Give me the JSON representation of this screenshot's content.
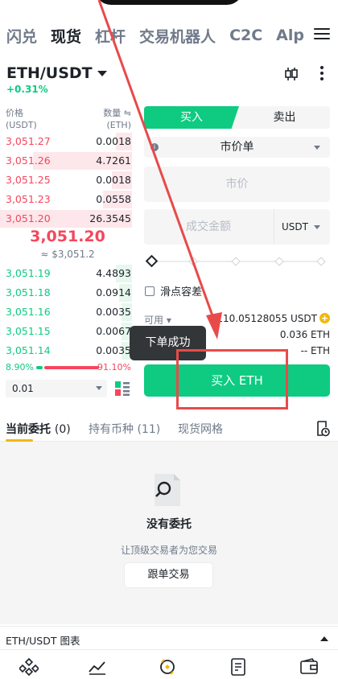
{
  "nav": {
    "tabs": [
      "闪兑",
      "现货",
      "杠杆",
      "交易机器人",
      "C2C",
      "Alp"
    ],
    "active": "现货"
  },
  "pair": {
    "symbol": "ETH/USDT",
    "change": "+0.31%"
  },
  "orderbook": {
    "price_header": "价格\n(USDT)",
    "qty_header": "数量 ⇋\n(ETH)",
    "asks": [
      {
        "price": "3,051.27",
        "qty": "0.0018",
        "depth": 0.12
      },
      {
        "price": "3,051.26",
        "qty": "4.7261",
        "depth": 0.75
      },
      {
        "price": "3,051.25",
        "qty": "0.0018",
        "depth": 0.15
      },
      {
        "price": "3,051.23",
        "qty": "0.0558",
        "depth": 0.22
      },
      {
        "price": "3,051.20",
        "qty": "26.3545",
        "depth": 1.0
      }
    ],
    "last_price": "3,051.20",
    "last_fiat": "≈ $3,051.2",
    "bids": [
      {
        "price": "3,051.19",
        "qty": "4.4893",
        "depth": 0.12
      },
      {
        "price": "3,051.18",
        "qty": "0.0914",
        "depth": 0.1
      },
      {
        "price": "3,051.16",
        "qty": "0.0035",
        "depth": 0.08
      },
      {
        "price": "3,051.15",
        "qty": "0.0067",
        "depth": 0.08
      },
      {
        "price": "3,051.14",
        "qty": "0.0035",
        "depth": 0.08
      }
    ],
    "buy_ratio": "8.90%",
    "sell_ratio": "91.10%",
    "precision": "0.01"
  },
  "form": {
    "buy_tab": "买入",
    "sell_tab": "卖出",
    "order_type": "市价单",
    "price_placeholder": "市价",
    "amount_placeholder": "成交金额",
    "amount_unit": "USDT",
    "slippage": "滑点容差",
    "available_label": "可用",
    "available_value": "110.05128055 USDT",
    "max_buy": "0.036 ETH",
    "fee": "-- ETH",
    "submit": "买入 ETH"
  },
  "toast": "下单成功",
  "bottom": {
    "tabs": [
      {
        "label": "当前委托",
        "count": "(0)"
      },
      {
        "label": "持有币种",
        "count": "(11)"
      },
      {
        "label": "现货网格",
        "count": ""
      }
    ],
    "empty_title": "没有委托",
    "empty_sub": "让顶级交易者为您交易",
    "copy_trade": "跟单交易",
    "chart_bar": "ETH/USDT 图表"
  },
  "colors": {
    "buy": "#0ecb81",
    "sell": "#f6465d",
    "accent": "#f0b90b",
    "annotation": "#e84a4a"
  },
  "icons": [
    "menu-icon",
    "candlestick-icon",
    "more-icon",
    "info-icon",
    "layout-icon",
    "history-icon",
    "search-document-icon",
    "home-icon",
    "markets-icon",
    "trade-icon",
    "futures-icon",
    "wallet-icon"
  ]
}
